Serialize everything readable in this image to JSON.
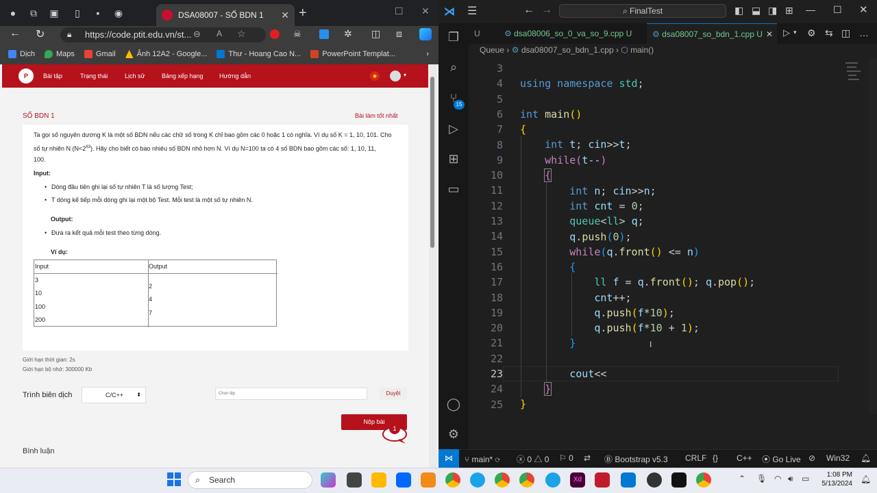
{
  "browser": {
    "tab_title": "DSA08007 - SỐ BDN 1",
    "url": "https://code.ptit.edu.vn/st...",
    "bookmarks": [
      "Dịch",
      "Maps",
      "Gmail",
      "Ảnh 12A2 - Google...",
      "Thư - Hoang Cao N...",
      "PowerPoint Templat..."
    ],
    "bookmark_colors": [
      "#4285f4",
      "#34a853",
      "#ea4335",
      "#fbbc04",
      "#0078d4",
      "#d04423"
    ]
  },
  "site": {
    "nav": [
      "Bài tập",
      "Trạng thái",
      "Lịch sử",
      "Bảng xếp hạng",
      "Hướng dẫn"
    ],
    "accent": "#b5121b",
    "problem_title": "SỐ BDN 1",
    "best_link": "Bài làm tốt nhất",
    "desc1": "Ta gọi số nguyên dương K là một số BDN nếu các chữ số trong K chỉ bao gồm các 0 hoặc 1 có nghĩa. Ví dụ số K = 1, 10, 101. Cho",
    "desc2a": "số tự nhiên N (N<2",
    "desc2sup": "63",
    "desc2b": "). Hãy cho biết có bao nhiêu số BDN nhỏ hơn N. Ví dụ N=100 ta có 4 số BDN bao gồm các số: 1, 10, 11,",
    "desc3": "100.",
    "input_label": "Input:",
    "input_bullets": [
      "Dòng đầu tiên ghi lại số tự nhiên T là số lượng Test;",
      "T dòng kế tiếp mỗi dòng ghi lại một bộ Test. Mỗi test là một số tự nhiên N."
    ],
    "output_label": "Output:",
    "output_bullet": "Đưa ra kết quả mỗi test theo từng dòng.",
    "example_label": "Ví dụ:",
    "table": {
      "headers": [
        "Input",
        "Output"
      ],
      "input_lines": [
        "3",
        "10",
        "100",
        "200"
      ],
      "output_lines": [
        "2",
        "4",
        "7"
      ]
    },
    "time_limit": "Giới hạn thời gian: 2s",
    "mem_limit": "Giới hạn bộ nhớ: 300000 Kb",
    "compiler_label": "Trình biên dịch",
    "compiler_value": "C/C++",
    "file_placeholder": "Chọn tệp",
    "browse": "Duyệt",
    "submit": "Nộp bài",
    "chat_count": "1",
    "comments": "Bình luận"
  },
  "vscode": {
    "search": "FinalTest",
    "tabs": [
      {
        "name": "U",
        "dirty": ""
      },
      {
        "name": "dsa08006_so_0_va_so_9.cpp",
        "dirty": "U"
      },
      {
        "name": "dsa08007_so_bdn_1.cpp",
        "dirty": "U"
      }
    ],
    "breadcrumb": [
      "Queue",
      "dsa08007_so_bdn_1.cpp",
      "main()"
    ],
    "badge": "15",
    "current_line": 23,
    "lines": [
      3,
      4,
      5,
      6,
      7,
      8,
      9,
      10,
      11,
      12,
      13,
      14,
      15,
      16,
      17,
      18,
      19,
      20,
      21,
      22,
      23,
      24,
      25
    ],
    "status": {
      "branch": "main*",
      "errors": "0",
      "warnings": "0",
      "ports": "0",
      "bootstrap": "Bootstrap v5.3",
      "eol": "CRLF",
      "braces": "{}",
      "lang": "C++",
      "golive": "Go Live",
      "platform": "Win32"
    }
  },
  "taskbar": {
    "search": "Search",
    "time": "1:08 PM",
    "date": "5/13/2024"
  }
}
